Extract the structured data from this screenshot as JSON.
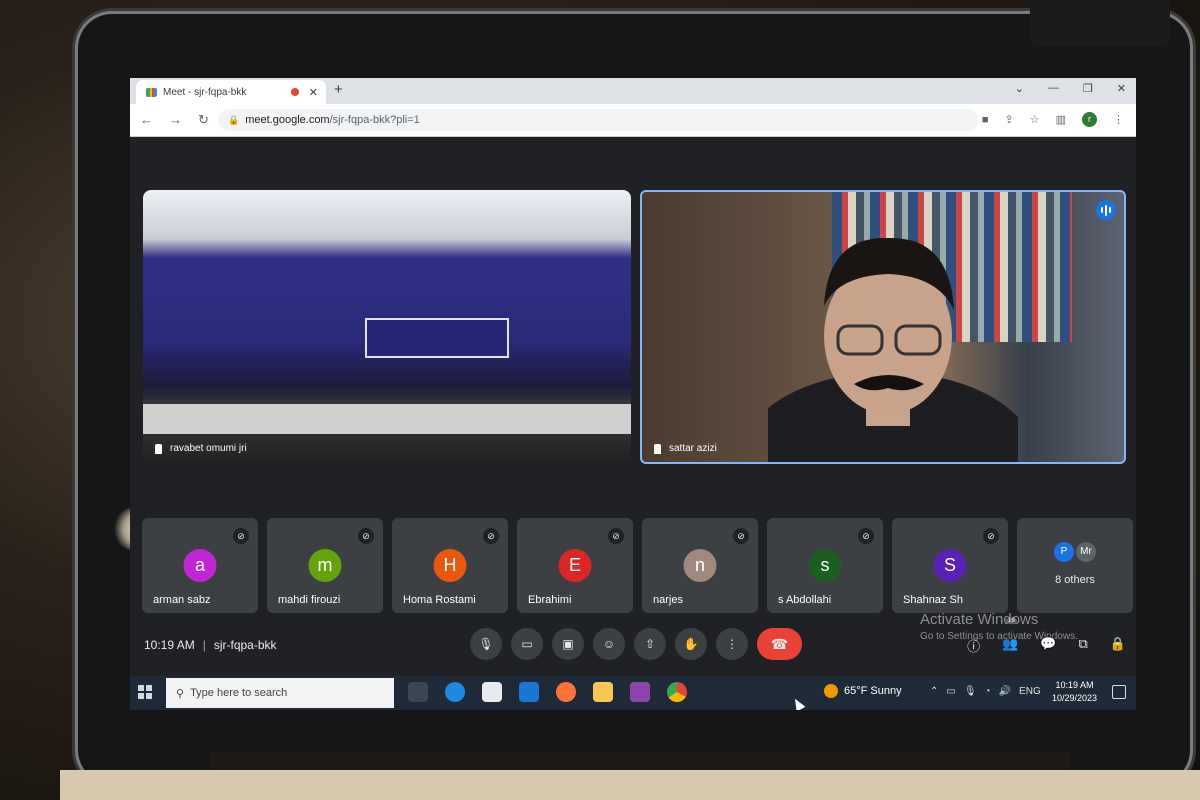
{
  "browser": {
    "tab_title": "Meet - sjr-fqpa-bkk",
    "tab_close": "✕",
    "new_tab": "+",
    "url_host": "meet.google.com",
    "url_path": "/sjr-fqpa-bkk?pli=1",
    "profile_initial": "r",
    "window_controls": [
      "⌄",
      "—",
      "❐",
      "✕"
    ]
  },
  "meet": {
    "main_tiles": [
      {
        "name": "ravabet omumi jri",
        "pinned": true
      },
      {
        "name": "sattar azizi",
        "speaking": true
      }
    ],
    "participants": [
      {
        "name": "arman sabz",
        "initial": "a",
        "color": "#c026d3"
      },
      {
        "name": "mahdi firouzi",
        "initial": "m",
        "color": "#65a30d"
      },
      {
        "name": "Homa Rostami",
        "initial": "H",
        "color": "#ea580c"
      },
      {
        "name": "Ebrahimi",
        "initial": "E",
        "color": "#dc2626"
      },
      {
        "name": "narjes",
        "initial": "n",
        "color": "#a1887f"
      },
      {
        "name": "s Abdollahi",
        "initial": "s",
        "color": "#1b5e20"
      },
      {
        "name": "Shahnaz Sh",
        "initial": "S",
        "color": "#5b21b6"
      }
    ],
    "others": {
      "label": "8 others",
      "mini": [
        {
          "initial": "P",
          "color": "#1a73e8"
        },
        {
          "initial": "Mr",
          "color": "#5f6368"
        }
      ]
    },
    "time": "10:19 AM",
    "meeting_code": "sjr-fqpa-bkk",
    "separator": "|",
    "people_badge": "19"
  },
  "watermark": {
    "line1": "Activate Windows",
    "line2": "Go to Settings to activate Windows."
  },
  "taskbar": {
    "search_placeholder": "Type here to search",
    "weather": "65°F  Sunny",
    "language": "ENG",
    "clock_time": "10:19 AM",
    "clock_date": "10/29/2023"
  }
}
